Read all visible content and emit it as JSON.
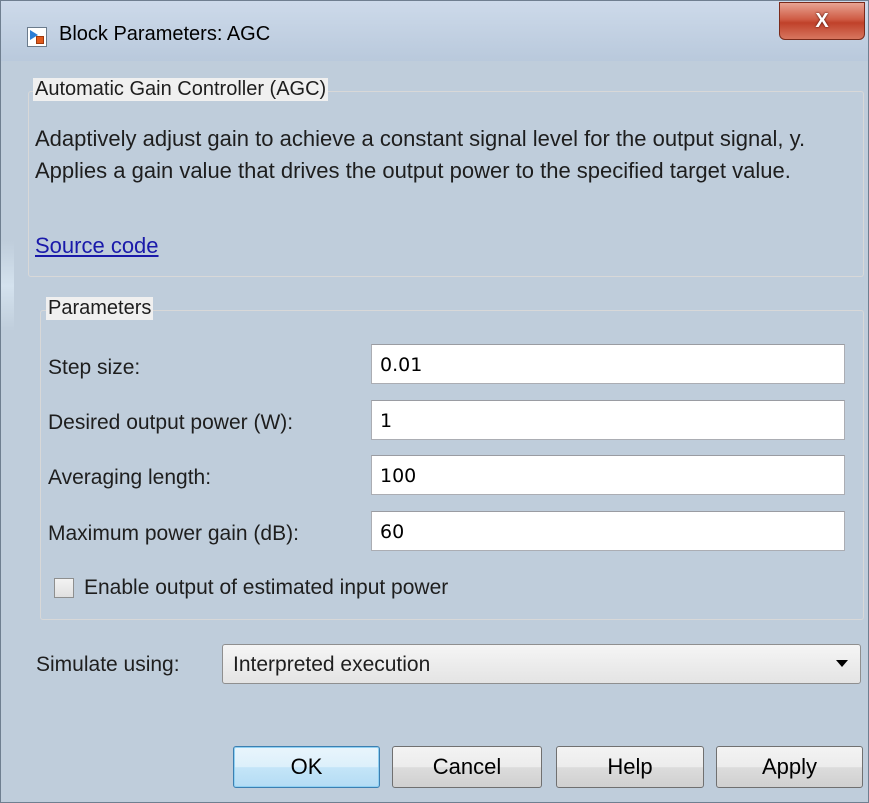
{
  "window": {
    "title": "Block Parameters: AGC",
    "close_glyph": "X",
    "icon": "simulink-block-icon"
  },
  "description": {
    "group_title": "Automatic Gain Controller (AGC)",
    "text": "Adaptively adjust gain to achieve a constant signal level for the output signal, y. Applies a gain value that drives the output power to the specified target value.",
    "link": "Source code"
  },
  "parameters": {
    "group_title": "Parameters",
    "fields": [
      {
        "label": "Step size:",
        "value": "0.01"
      },
      {
        "label": "Desired output power (W):",
        "value": "1"
      },
      {
        "label": "Averaging length:",
        "value": "100"
      },
      {
        "label": "Maximum power gain (dB):",
        "value": "60"
      }
    ],
    "checkbox": {
      "label": "Enable output of estimated input power",
      "checked": false
    }
  },
  "simulate": {
    "label": "Simulate using:",
    "selected": "Interpreted execution"
  },
  "buttons": {
    "ok": "OK",
    "cancel": "Cancel",
    "help": "Help",
    "apply": "Apply"
  },
  "colors": {
    "link": "#1a1aaa",
    "close_button": "#c0412a",
    "default_button": "#c4e5f8"
  }
}
